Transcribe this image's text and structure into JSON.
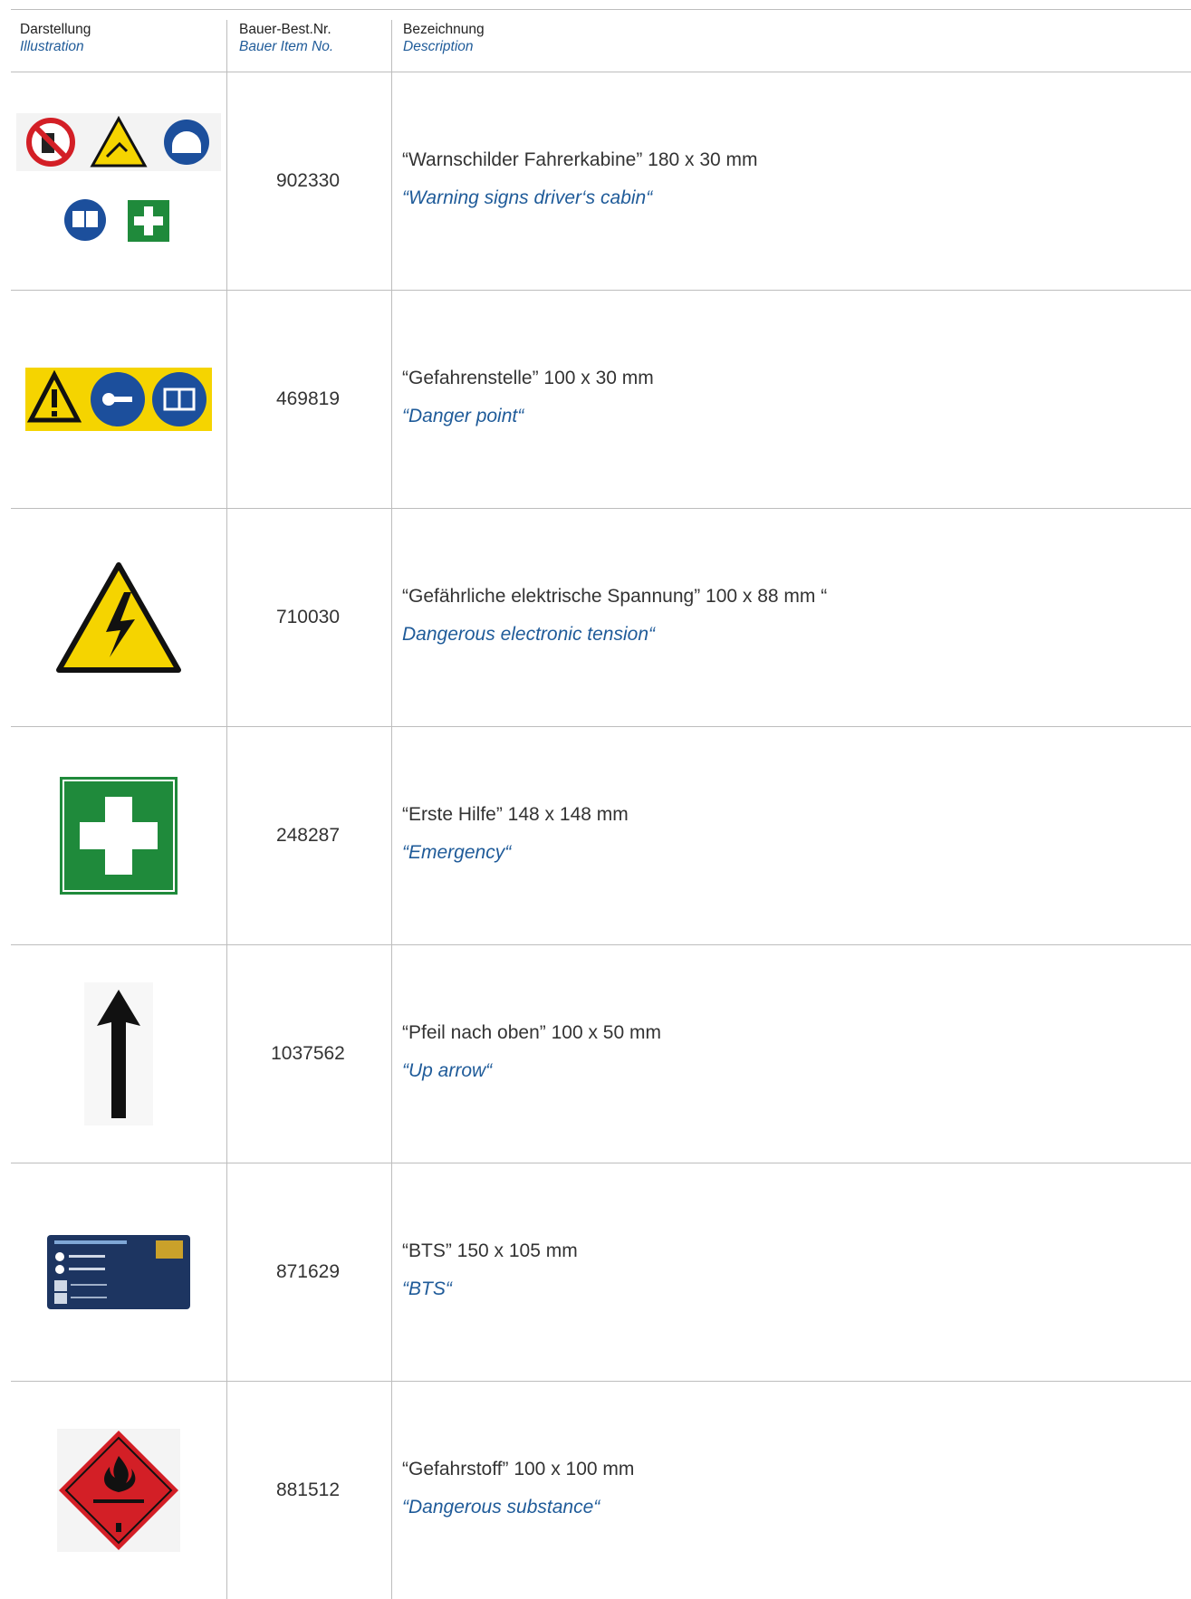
{
  "header": {
    "col1": {
      "de": "Darstellung",
      "en": "Illustration"
    },
    "col2": {
      "de": "Bauer-Best.Nr.",
      "en": "Bauer Item No."
    },
    "col3": {
      "de": "Bezeichnung",
      "en": "Description"
    }
  },
  "rows": [
    {
      "icon": "cabin-warning-signs-icon",
      "item_no": "902330",
      "de": "“Warnschilder Fahrerkabine” 180 x 30 mm",
      "en": "“Warning signs driver‘s cabin“"
    },
    {
      "icon": "danger-point-sign-icon",
      "item_no": "469819",
      "de": "“Gefahrenstelle” 100 x 30 mm",
      "en": "“Danger point“"
    },
    {
      "icon": "electric-hazard-sign-icon",
      "item_no": "710030",
      "de": "“Gefährliche elektrische Spannung” 100 x 88 mm “",
      "en": " Dangerous electronic tension“"
    },
    {
      "icon": "first-aid-sign-icon",
      "item_no": "248287",
      "de": "“Erste Hilfe” 148 x 148 mm",
      "en": "“Emergency“"
    },
    {
      "icon": "up-arrow-sign-icon",
      "item_no": "1037562",
      "de": "“Pfeil nach oben” 100 x 50 mm",
      "en": "“Up arrow“"
    },
    {
      "icon": "bts-card-sign-icon",
      "item_no": "871629",
      "de": "“BTS” 150 x 105 mm",
      "en": "“BTS“"
    },
    {
      "icon": "flammable-liquid-sign-icon",
      "item_no": "881512",
      "de": "“Gefahrstoff” 100 x 100 mm",
      "en": "“Dangerous substance“"
    }
  ],
  "colors": {
    "english_text": "#1f5b99",
    "rule": "#bdbdbd",
    "warning_yellow": "#f5d400",
    "safety_blue": "#1c4f9c",
    "safety_green": "#1f8a3b",
    "danger_red": "#d31f26"
  }
}
